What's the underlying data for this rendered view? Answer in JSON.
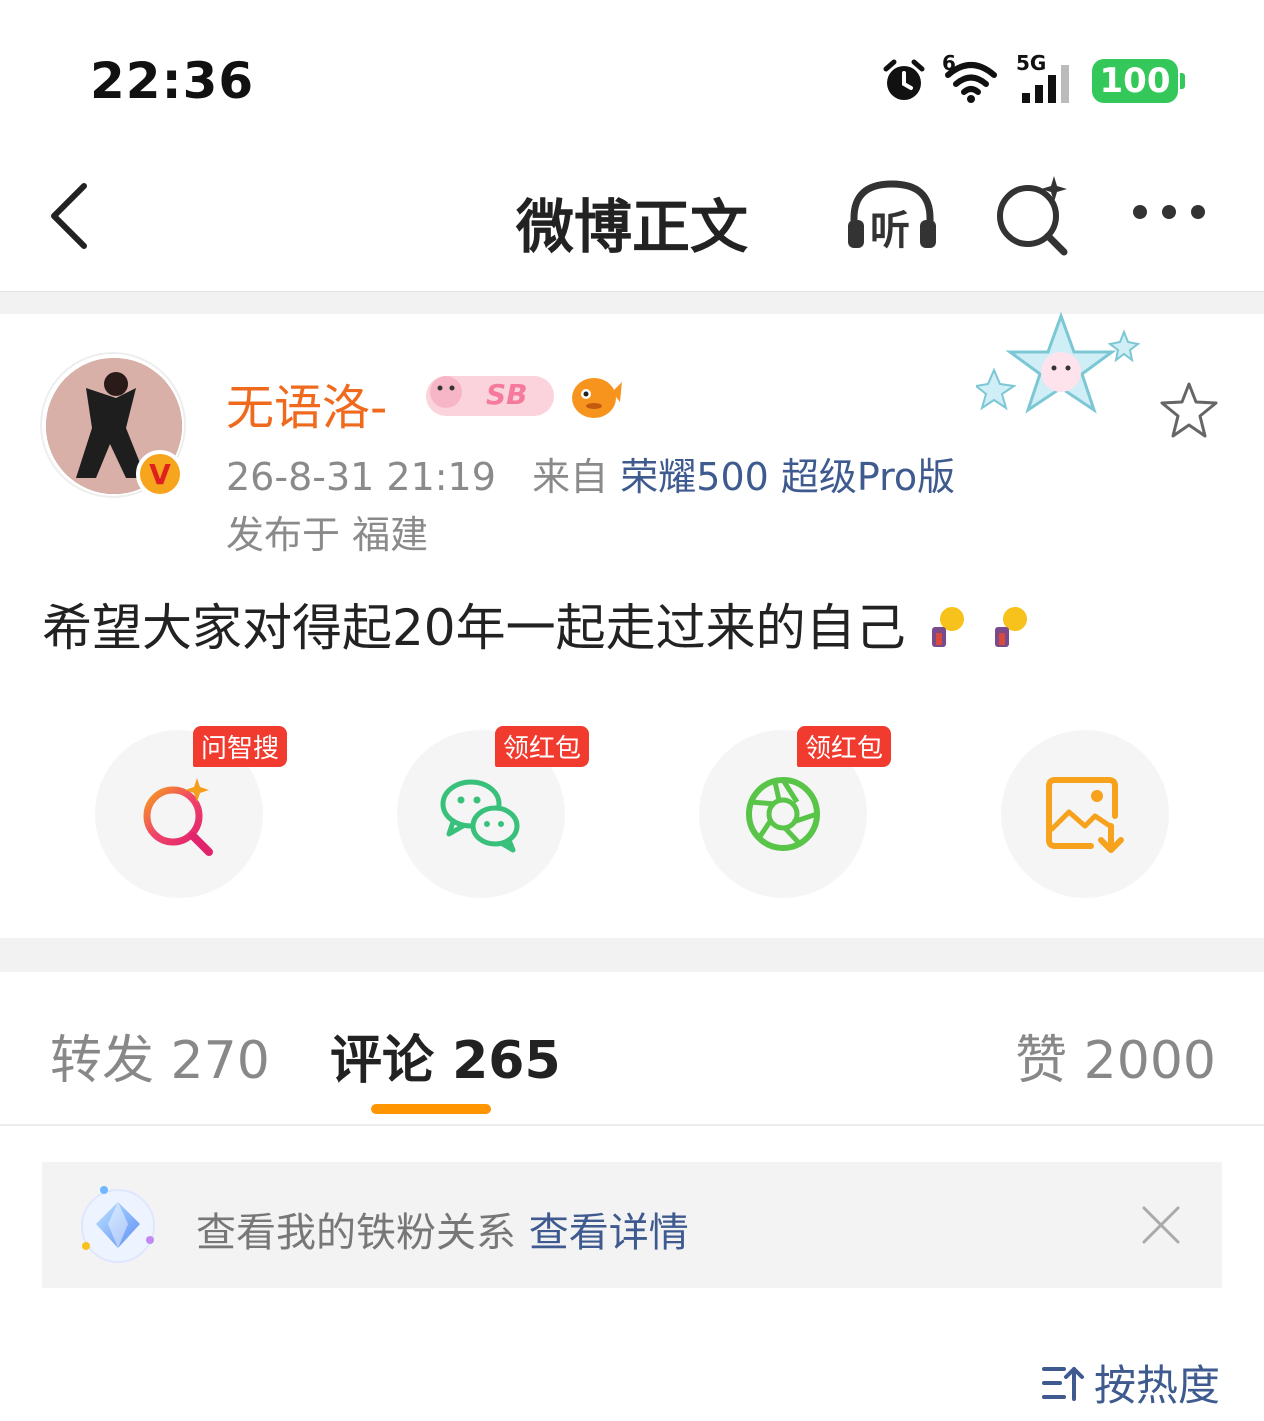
{
  "status_bar": {
    "time": "22:36",
    "network": "5G",
    "wifi_badge": "6",
    "battery": "100"
  },
  "nav": {
    "title": "微博正文",
    "listen_label": "听"
  },
  "post": {
    "user_name": "无语洛-",
    "medal_label": "SB",
    "timestamp": "26-8-31 21:19",
    "source_prefix": "来自",
    "device": "荣耀500 超级Pro版",
    "location": "发布于 福建",
    "text": "希望大家对得起20年一起走过来的自己"
  },
  "actions": [
    {
      "tag": "问智搜",
      "icon": "ai-search-icon"
    },
    {
      "tag": "领红包",
      "icon": "wechat-icon"
    },
    {
      "tag": "领红包",
      "icon": "moments-icon"
    },
    {
      "tag": "",
      "icon": "save-image-icon"
    }
  ],
  "tabs": {
    "repost": "转发 270",
    "comment": "评论 265",
    "like": "赞 2000"
  },
  "fan_banner": {
    "text": "查看我的铁粉关系",
    "link": "查看详情"
  },
  "sort": {
    "label": "按热度"
  },
  "colors": {
    "accent": "#ff9500",
    "username": "#f06a1e",
    "link": "#3e5a8f",
    "tag_red": "#f23b2f",
    "battery": "#34c759"
  }
}
